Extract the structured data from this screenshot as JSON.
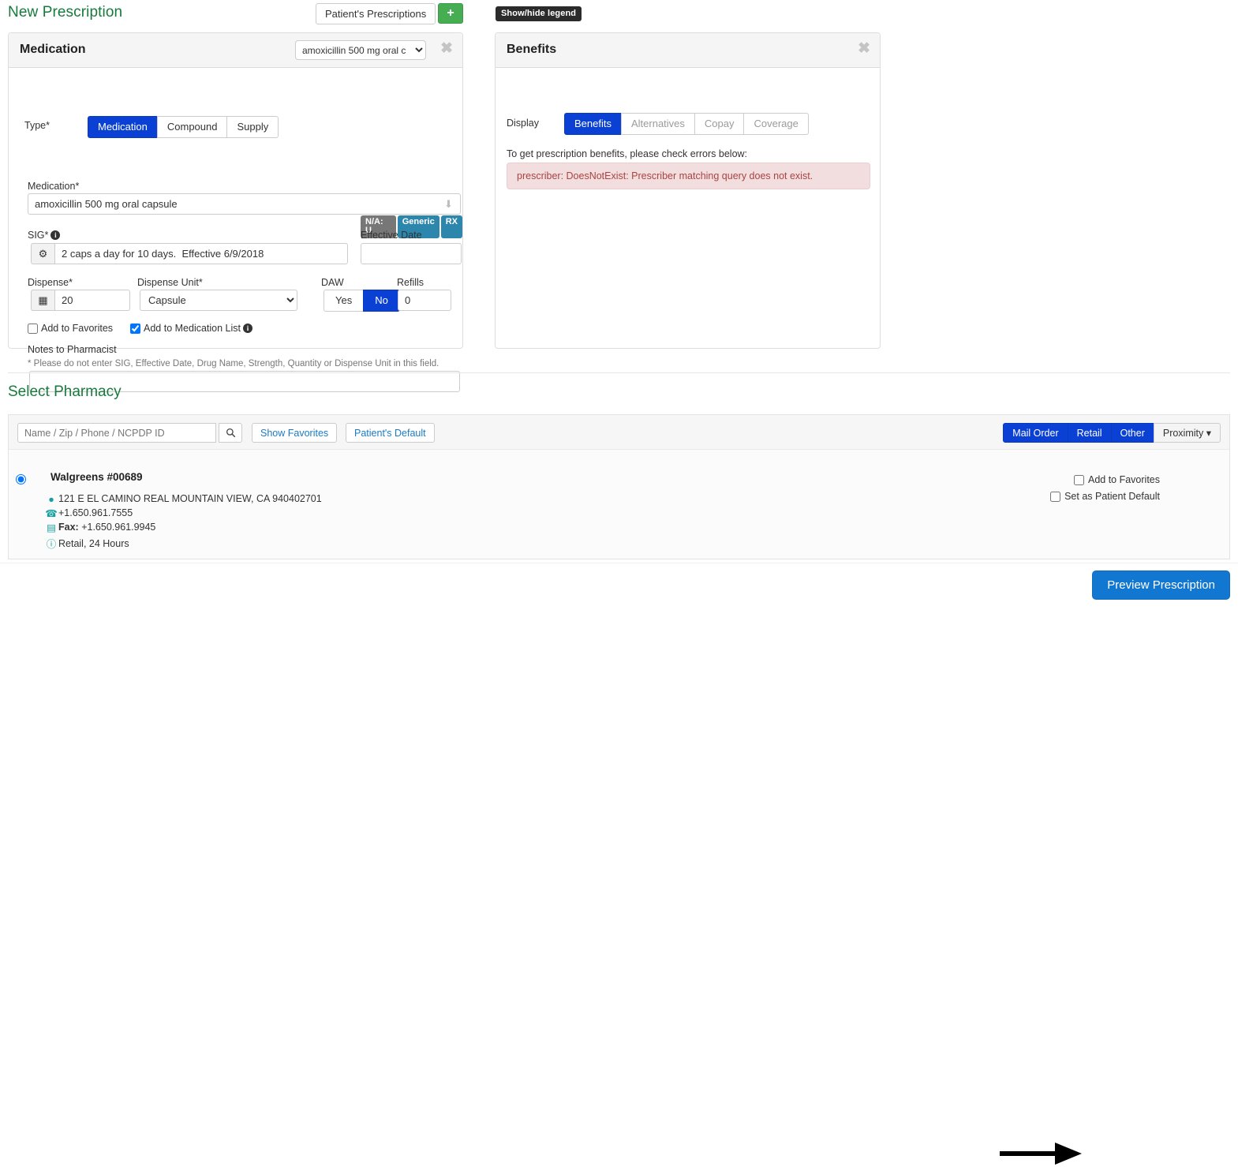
{
  "header": {
    "title": "New Prescription",
    "patients_prescriptions_label": "Patient's Prescriptions",
    "add_label": "+",
    "legend_tooltip": "Show/hide legend"
  },
  "medication_panel": {
    "title": "Medication",
    "header_select_value": "amoxicillin 500 mg oral c",
    "close_label": "✖",
    "type": {
      "label": "Type*",
      "options": [
        "Medication",
        "Compound",
        "Supply"
      ],
      "selected": "Medication"
    },
    "medication": {
      "label": "Medication*",
      "value": "amoxicillin 500 mg oral capsule",
      "placeholder": ""
    },
    "badges": [
      {
        "text": "N/A: U",
        "style": "gray"
      },
      {
        "text": "Generic",
        "style": "blue"
      },
      {
        "text": "RX",
        "style": "blue"
      }
    ],
    "sig": {
      "label": "SIG*",
      "info": "i",
      "gear_icon": "gear-icon",
      "value": "2 caps a day for 10 days.  Effective 6/9/2018"
    },
    "effective_date": {
      "label": "Effective Date",
      "value": ""
    },
    "dispense": {
      "label": "Dispense*",
      "value": "20",
      "calc_icon": "calculator-icon"
    },
    "dispense_unit": {
      "label": "Dispense Unit*",
      "value": "Capsule",
      "options": [
        "Capsule"
      ]
    },
    "daw": {
      "label": "DAW",
      "options": [
        "Yes",
        "No"
      ],
      "selected": "No"
    },
    "refills": {
      "label": "Refills",
      "value": "0"
    },
    "add_to_favorites": {
      "label": "Add to Favorites",
      "checked": false
    },
    "add_to_medication_list": {
      "label": "Add to Medication List",
      "checked": true,
      "info": "i"
    },
    "notes": {
      "label": "Notes to Pharmacist",
      "help": "* Please do not enter SIG, Effective Date, Drug Name, Strength, Quantity or Dispense Unit in this field.",
      "value": ""
    }
  },
  "benefits_panel": {
    "title": "Benefits",
    "close_label": "✖",
    "display": {
      "label": "Display",
      "options": [
        "Benefits",
        "Alternatives",
        "Copay",
        "Coverage"
      ],
      "selected": "Benefits"
    },
    "message": "To get prescription benefits, please check errors below:",
    "error": "prescriber: DoesNotExist: Prescriber matching query does not exist."
  },
  "pharmacy": {
    "section_title": "Select Pharmacy",
    "search_placeholder": "Name / Zip / Phone / NCPDP ID",
    "search_value": "",
    "search_icon": "search-icon",
    "show_favorites_label": "Show Favorites",
    "patients_default_label": "Patient's Default",
    "filters": [
      {
        "label": "Mail Order",
        "active": true
      },
      {
        "label": "Retail",
        "active": true
      },
      {
        "label": "Other",
        "active": true
      },
      {
        "label": "Proximity ▾",
        "active": false
      }
    ],
    "result": {
      "selected": true,
      "name": "Walgreens #00689",
      "address": "121 E EL CAMINO REAL MOUNTAIN VIEW, CA 940402701",
      "phone": "+1.650.961.7555",
      "fax_label": "Fax:",
      "fax": "+1.650.961.9945",
      "info": "Retail, 24 Hours",
      "address_icon": "map-pin-icon",
      "phone_icon": "phone-icon",
      "fax_icon": "fax-icon",
      "info_icon": "info-icon",
      "add_to_favorites": {
        "label": "Add to Favorites",
        "checked": false
      },
      "set_as_patient_default": {
        "label": "Set as Patient Default",
        "checked": false
      }
    }
  },
  "footer": {
    "preview_label": "Preview Prescription"
  },
  "colors": {
    "accent_green": "#177a3c",
    "primary_blue": "#0a41d4",
    "preview_blue": "#1177d1",
    "error_text": "#a94442",
    "error_bg": "#f2dede",
    "badge_gray": "#777777",
    "badge_blue": "#2d86ab",
    "teal_icon": "#18a0a0"
  }
}
